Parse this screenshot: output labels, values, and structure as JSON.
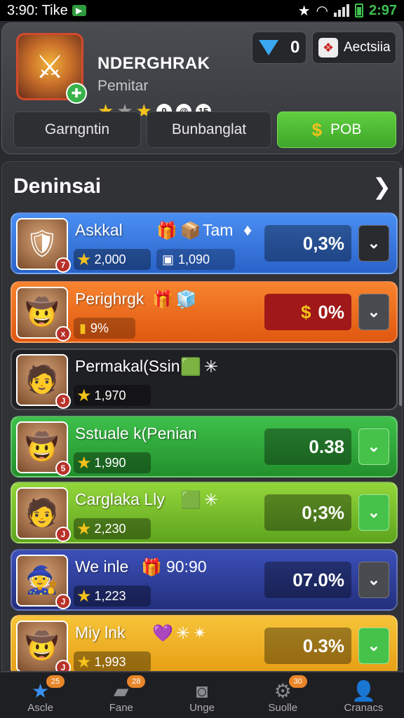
{
  "status_bar": {
    "time": "3:90: Tike",
    "right_time": "2:97"
  },
  "profile": {
    "name": "NDERGHRAK",
    "subtitle": "Pemitar",
    "stars": 2,
    "chips": [
      "0",
      "@",
      "15"
    ],
    "gems": "0",
    "action_label": "Aectsiia"
  },
  "tabs": [
    {
      "label": "Garngntin"
    },
    {
      "label": "Bunbanglat"
    },
    {
      "label": "POB"
    }
  ],
  "section": {
    "title": "Deninsai"
  },
  "rows": [
    {
      "name": "Askkal",
      "tag": "Tam",
      "score": "2,000",
      "score2": "1,090",
      "percent": "0,3%",
      "avatar_badge": "7",
      "toggle": "v"
    },
    {
      "name": "Perighrgk",
      "score": "9%",
      "percent": "0%",
      "avatar_badge": "x",
      "toggle": "v"
    },
    {
      "name": "Permakal(Ssin",
      "score": "1,970",
      "percent": "",
      "avatar_badge": "J"
    },
    {
      "name": "Sstuale k(Penian",
      "score": "1,990",
      "percent": "0.38",
      "avatar_badge": "5",
      "toggle": "v"
    },
    {
      "name": "Carglaka Lly",
      "score": "2,230",
      "percent": "0;3%",
      "avatar_badge": "J",
      "toggle": "v"
    },
    {
      "name": "We inle",
      "tag": "90:90",
      "score": "1,223",
      "percent": "07.0%",
      "avatar_badge": "J",
      "toggle": "v"
    },
    {
      "name": "Miy lnk",
      "score": "1,993",
      "percent": "0.3%",
      "avatar_badge": "J",
      "toggle": "v"
    }
  ],
  "bottom_nav": [
    {
      "label": "Ascle",
      "badge": "25",
      "icon": "star-icon"
    },
    {
      "label": "Fane",
      "badge": "28",
      "icon": "folder-icon"
    },
    {
      "label": "Unge",
      "badge": "",
      "icon": "camera-icon"
    },
    {
      "label": "Suolle",
      "badge": "30",
      "icon": "gear-icon"
    },
    {
      "label": "Cranacs",
      "badge": "",
      "icon": "user-icon"
    }
  ],
  "colors": {
    "accent_green": "#46c24a",
    "accent_blue": "#3a8ff0",
    "star": "#f4c21c"
  }
}
